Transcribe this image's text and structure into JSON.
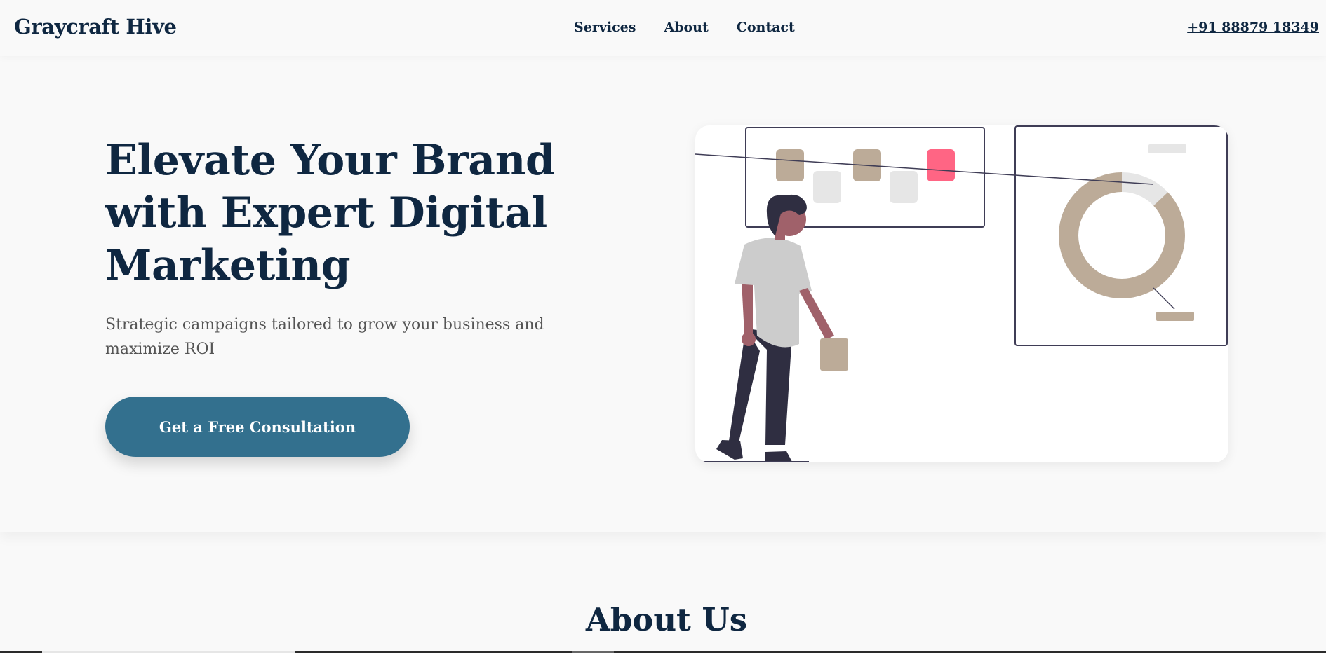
{
  "header": {
    "brand": "Graycraft Hive",
    "nav": [
      {
        "label": "Services"
      },
      {
        "label": "About"
      },
      {
        "label": "Contact"
      }
    ],
    "phone": "+91 88879 18349"
  },
  "hero": {
    "title": "Elevate Your Brand with Expert Digital Marketing",
    "subtitle": "Strategic campaigns tailored to grow your business and maximize ROI",
    "cta_label": "Get a Free Consultation",
    "donut_chart": {
      "filled_fraction": 0.87
    }
  },
  "about": {
    "title": "About Us"
  },
  "colors": {
    "primary": "#0f2741",
    "accent": "#33708e",
    "muted_text": "#555555",
    "illustration_tan": "#bcab98",
    "illustration_light": "#e6e6e6",
    "illustration_pink": "#ff6584",
    "illustration_dark": "#2f2e41",
    "illustration_skin": "#a0616a",
    "background": "#f9f9f9"
  }
}
